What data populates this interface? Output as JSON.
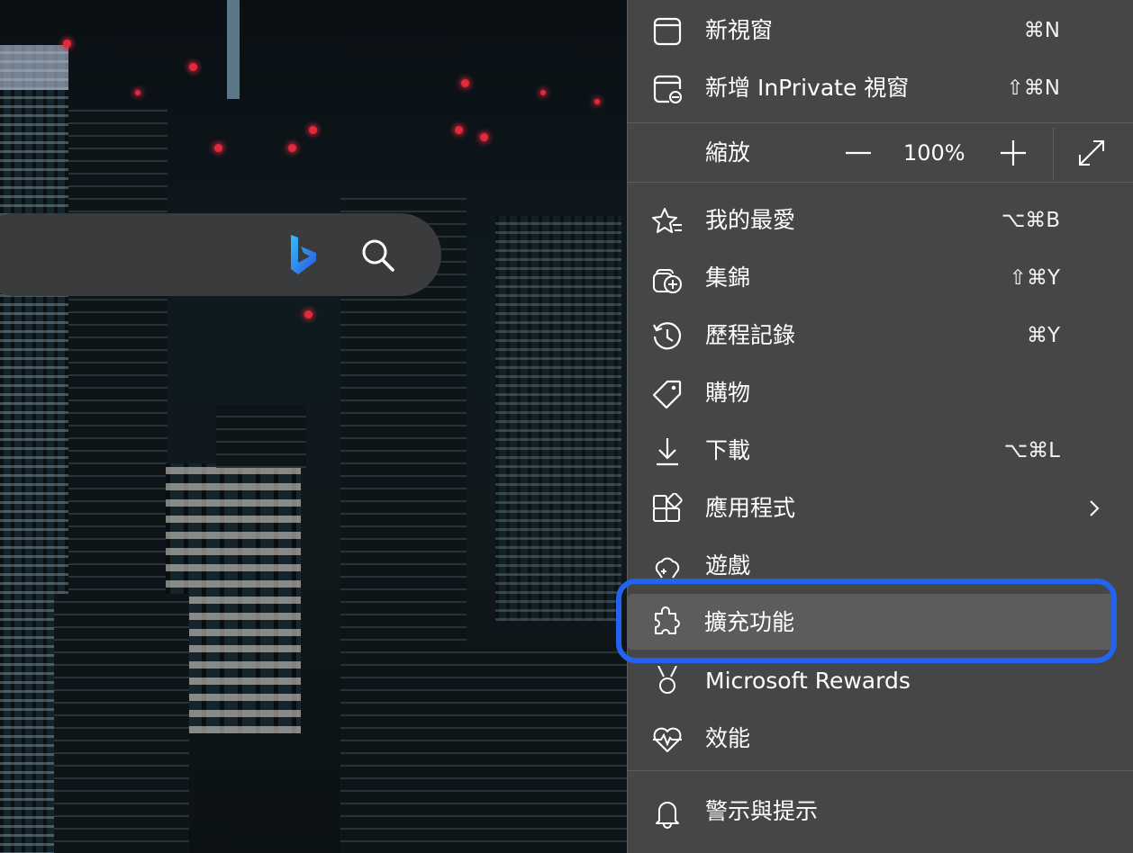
{
  "search": {
    "bing_icon": "bing-logo-icon",
    "search_icon": "search-icon"
  },
  "menu": {
    "items": [
      {
        "label": "新視窗",
        "shortcut": "⌘N",
        "icon": "window-icon"
      },
      {
        "label": "新增 InPrivate 視窗",
        "shortcut": "⇧⌘N",
        "icon": "inprivate-window-icon"
      },
      {
        "label": "我的最愛",
        "shortcut": "⌥⌘B",
        "icon": "favorites-icon"
      },
      {
        "label": "集錦",
        "shortcut": "⇧⌘Y",
        "icon": "collections-icon"
      },
      {
        "label": "歷程記錄",
        "shortcut": "⌘Y",
        "icon": "history-icon"
      },
      {
        "label": "購物",
        "shortcut": "",
        "icon": "shopping-tag-icon"
      },
      {
        "label": "下載",
        "shortcut": "⌥⌘L",
        "icon": "download-icon"
      },
      {
        "label": "應用程式",
        "shortcut": "",
        "icon": "apps-icon"
      },
      {
        "label": "遊戲",
        "shortcut": "",
        "icon": "games-icon"
      },
      {
        "label": "擴充功能",
        "shortcut": "",
        "icon": "extensions-puzzle-icon"
      },
      {
        "label": "Microsoft Rewards",
        "shortcut": "",
        "icon": "rewards-medal-icon"
      },
      {
        "label": "效能",
        "shortcut": "",
        "icon": "performance-heart-icon"
      },
      {
        "label": "警示與提示",
        "shortcut": "",
        "icon": "bell-icon"
      }
    ],
    "zoom": {
      "label": "縮放",
      "value": "100%",
      "minus_icon": "minus-icon",
      "plus_icon": "plus-icon",
      "fullscreen_icon": "fullscreen-icon"
    }
  },
  "colors": {
    "menu_bg": "#464646",
    "highlight_bg": "#5c5c5c",
    "focus_ring": "#2264f0"
  }
}
